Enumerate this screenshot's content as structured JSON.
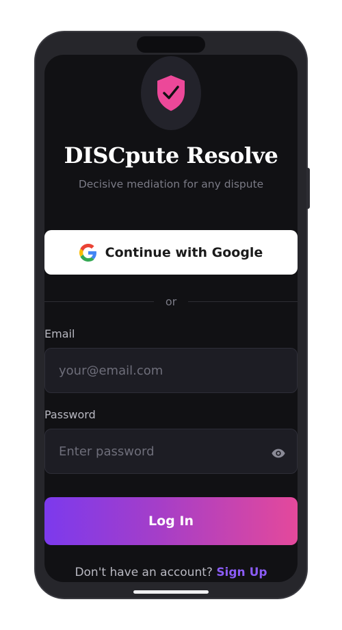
{
  "app": {
    "title": "DISCpute Resolve",
    "subtitle": "Decisive mediation for any dispute",
    "logo_icon": "shield-check-icon",
    "logo_color": "#ec4899"
  },
  "google": {
    "label": "Continue with Google",
    "icon": "google-g-icon"
  },
  "divider": {
    "text": "or"
  },
  "email": {
    "label": "Email",
    "placeholder": "your@email.com",
    "value": ""
  },
  "password": {
    "label": "Password",
    "placeholder": "Enter password",
    "value": "",
    "toggle_icon": "eye-icon"
  },
  "login": {
    "label": "Log In",
    "gradient": [
      "#7c3aed",
      "#e4499b"
    ]
  },
  "signup": {
    "prompt": "Don't have an account?",
    "link": "Sign Up",
    "link_color": "#8b5cf6"
  }
}
